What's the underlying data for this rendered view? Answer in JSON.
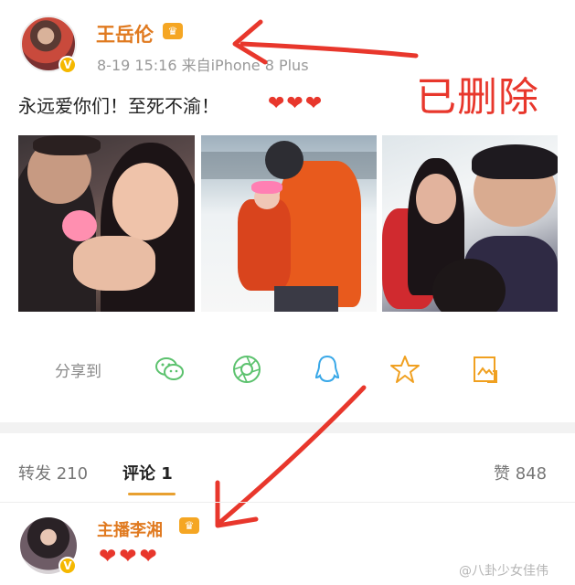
{
  "post": {
    "username": "王岳伦",
    "meta": "8-19 15:16  来自iPhone 8 Plus",
    "content": "永远爱你们！至死不渝！",
    "hearts": "❤❤❤",
    "annotation": "已删除"
  },
  "share": {
    "label": "分享到",
    "icons": [
      "wechat-icon",
      "moments-icon",
      "qq-icon",
      "favorite-star-icon",
      "save-image-icon"
    ]
  },
  "tabs": {
    "repost": "转发 210",
    "comment": "评论 1",
    "like": "赞 848"
  },
  "comment": {
    "username": "主播李湘",
    "hearts": "❤❤❤"
  },
  "watermark": "@八卦少女佳伟",
  "colors": {
    "username": "#e07a20",
    "annotation": "#e8372c",
    "accent_underline": "#e8a030",
    "vip_badge": "#f5b800"
  }
}
